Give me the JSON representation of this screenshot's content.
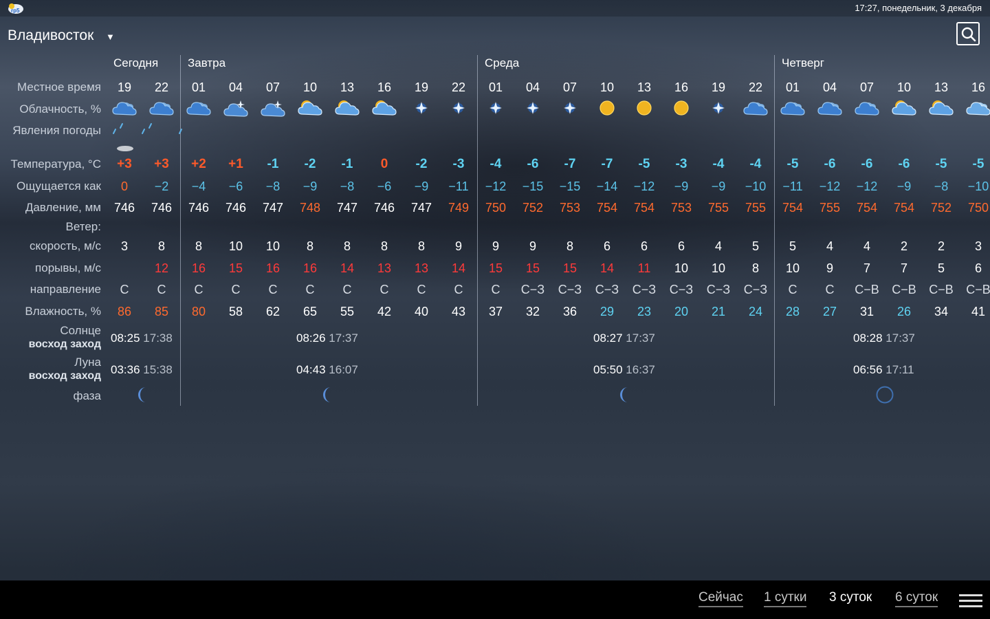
{
  "status": {
    "time": "17:27, понедельник, 3 декабря",
    "app_logo_text": "rp5"
  },
  "header": {
    "city": "Владивосток"
  },
  "labels": {
    "local_time": "Местное время",
    "cloudiness": "Облачность, %",
    "phenomena": "Явления погоды",
    "temperature": "Температура, °C",
    "feels_like": "Ощущается как",
    "pressure": "Давление, мм",
    "wind": "Ветер:",
    "speed": "скорость, м/с",
    "gusts": "порывы, м/с",
    "direction": "направление",
    "humidity": "Влажность, %",
    "sun": "Солнце",
    "sun_sub": "восход заход",
    "moon": "Луна",
    "moon_sub": "восход заход",
    "phase": "фаза"
  },
  "days": [
    "Сегодня",
    "Завтра",
    "Среда",
    "Четверг"
  ],
  "hours": [
    "19",
    "22",
    "01",
    "04",
    "07",
    "10",
    "13",
    "16",
    "19",
    "22",
    "01",
    "04",
    "07",
    "10",
    "13",
    "16",
    "19",
    "22",
    "01",
    "04",
    "07",
    "10",
    "13",
    "16"
  ],
  "cloud_icons": [
    "cloud-dark",
    "cloud-dark",
    "cloud-dark",
    "cloud-star",
    "cloud-star",
    "cloud-sun",
    "cloud-sun",
    "cloud-sun",
    "star",
    "star",
    "star",
    "star",
    "star",
    "sun",
    "sun",
    "sun",
    "star",
    "cloud-dark",
    "cloud-dark",
    "cloud-dark",
    "cloud-dark",
    "cloud-sun",
    "cloud-sun",
    "cloud-light"
  ],
  "temperature": [
    "+3",
    "+3",
    "+2",
    "+1",
    "-1",
    "-2",
    "-1",
    "0",
    "-2",
    "-3",
    "-4",
    "-6",
    "-7",
    "-7",
    "-5",
    "-3",
    "-4",
    "-4",
    "-5",
    "-6",
    "-6",
    "-6",
    "-5",
    "-5"
  ],
  "temperature_colors": [
    "red",
    "red",
    "red",
    "red",
    "cyan",
    "cyan",
    "cyan",
    "red",
    "cyan",
    "cyan",
    "cyan",
    "cyan",
    "cyan",
    "cyan",
    "cyan",
    "cyan",
    "cyan",
    "cyan",
    "cyan",
    "cyan",
    "cyan",
    "cyan",
    "cyan",
    "cyan"
  ],
  "feels_like": [
    "0",
    "−2",
    "−4",
    "−6",
    "−8",
    "−9",
    "−8",
    "−6",
    "−9",
    "−11",
    "−12",
    "−15",
    "−15",
    "−14",
    "−12",
    "−9",
    "−9",
    "−10",
    "−11",
    "−12",
    "−12",
    "−9",
    "−8",
    "−10"
  ],
  "feels_like_colors": [
    "org",
    "fl",
    "fl",
    "fl",
    "fl",
    "fl",
    "fl",
    "fl",
    "fl",
    "fl",
    "fl",
    "fl",
    "fl",
    "fl",
    "fl",
    "fl",
    "fl",
    "fl",
    "fl",
    "fl",
    "fl",
    "fl",
    "fl",
    "fl"
  ],
  "pressure": [
    "746",
    "746",
    "746",
    "746",
    "747",
    "748",
    "747",
    "746",
    "747",
    "749",
    "750",
    "752",
    "753",
    "754",
    "754",
    "753",
    "755",
    "755",
    "754",
    "755",
    "754",
    "754",
    "752",
    "750"
  ],
  "pressure_colors": [
    "wht",
    "wht",
    "wht",
    "wht",
    "wht",
    "org",
    "wht",
    "wht",
    "wht",
    "org",
    "org",
    "org",
    "org",
    "org",
    "org",
    "org",
    "org",
    "org",
    "org",
    "org",
    "org",
    "org",
    "org",
    "org"
  ],
  "wind_speed": [
    "3",
    "8",
    "8",
    "10",
    "10",
    "8",
    "8",
    "8",
    "8",
    "9",
    "9",
    "9",
    "8",
    "6",
    "6",
    "6",
    "4",
    "5",
    "5",
    "4",
    "4",
    "2",
    "2",
    "3"
  ],
  "wind_gusts": [
    "",
    "12",
    "16",
    "15",
    "16",
    "16",
    "14",
    "13",
    "13",
    "14",
    "15",
    "15",
    "15",
    "14",
    "11",
    "10",
    "10",
    "8",
    "10",
    "9",
    "7",
    "7",
    "5",
    "6"
  ],
  "wind_gusts_colors": [
    "wht",
    "gred",
    "gred",
    "gred",
    "gred",
    "gred",
    "gred",
    "gred",
    "gred",
    "gred",
    "gred",
    "gred",
    "gred",
    "gred",
    "gred",
    "wht",
    "wht",
    "wht",
    "wht",
    "wht",
    "wht",
    "wht",
    "wht",
    "wht"
  ],
  "wind_direction": [
    "С",
    "С",
    "С",
    "С",
    "С",
    "С",
    "С",
    "С",
    "С",
    "С",
    "С",
    "С−З",
    "С−З",
    "С−З",
    "С−З",
    "С−З",
    "С−З",
    "С−З",
    "С",
    "С",
    "С−В",
    "С−В",
    "С−В",
    "С−В"
  ],
  "humidity": [
    "86",
    "85",
    "80",
    "58",
    "62",
    "65",
    "55",
    "42",
    "40",
    "43",
    "37",
    "32",
    "36",
    "29",
    "23",
    "20",
    "21",
    "24",
    "28",
    "27",
    "31",
    "26",
    "34",
    "41"
  ],
  "humidity_colors": [
    "org",
    "org",
    "org",
    "wht",
    "wht",
    "wht",
    "wht",
    "wht",
    "wht",
    "wht",
    "wht",
    "wht",
    "wht",
    "cyan",
    "cyan",
    "cyan",
    "cyan",
    "cyan",
    "cyan",
    "cyan",
    "wht",
    "cyan",
    "wht",
    "wht"
  ],
  "sun": [
    {
      "rise": "08:25",
      "set": "17:38"
    },
    {
      "rise": "08:26",
      "set": "17:37"
    },
    {
      "rise": "08:27",
      "set": "17:37"
    },
    {
      "rise": "08:28",
      "set": "17:37"
    }
  ],
  "moon": [
    {
      "rise": "03:36",
      "set": "15:38"
    },
    {
      "rise": "04:43",
      "set": "16:07"
    },
    {
      "rise": "05:50",
      "set": "16:37"
    },
    {
      "rise": "06:56",
      "set": "17:11"
    }
  ],
  "moon_phases": [
    "waning-crescent",
    "waning-crescent",
    "waning-crescent",
    "new-moon"
  ],
  "tabs": [
    "Сейчас",
    "1 сутки",
    "3 суток",
    "6 суток"
  ],
  "active_tab": "3 суток",
  "icons": {
    "search": "search-icon",
    "menu": "menu-icon",
    "city_dropdown": "chevron-down-icon"
  }
}
